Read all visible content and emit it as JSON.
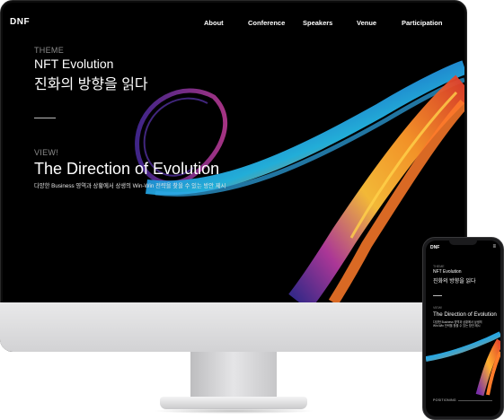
{
  "desktop": {
    "logo": "DNF",
    "nav": [
      "About",
      "Conference",
      "Speakers",
      "Venue",
      "Participation"
    ],
    "theme_label": "THEME",
    "theme_title_en": "NFT Evolution",
    "theme_title_ko": "진화의 방향을 읽다",
    "view_label": "VIEW!",
    "headline": "The Direction of Evolution",
    "description": "다양한 Business 영역과 상황에서 상생의 Win-Win 전략을 찾을 수 있는 방안 제시"
  },
  "mobile": {
    "logo": "DNF",
    "menu_icon": "hamburger-icon",
    "theme_label": "THEME",
    "theme_title_en": "NFT Evolution",
    "theme_title_ko": "진화의 방향을 읽다",
    "view_label": "VIEW!",
    "headline": "The Direction of Evolution",
    "description": "다양한 Business 영역과 상황에서 상생의 Win-Win 전략을 찾을 수 있는 방안 제시",
    "section_label": "POSITIONING"
  },
  "colors": {
    "background": "#000000",
    "swirl_blue": "#1f6fd1",
    "swirl_purple": "#7b3fd6",
    "swirl_orange": "#ff8a1e",
    "swirl_red": "#e2412b"
  }
}
